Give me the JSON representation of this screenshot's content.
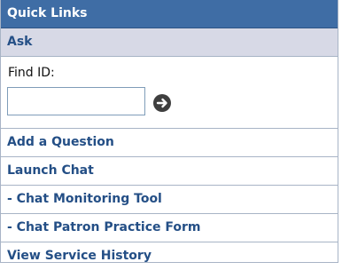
{
  "header": {
    "title": "Quick Links"
  },
  "ask_section": {
    "title": "Ask"
  },
  "find": {
    "label": "Find ID:",
    "value": "",
    "go_icon": "arrow-right-circle"
  },
  "links": [
    {
      "label": "Add a Question"
    },
    {
      "label": "Launch Chat"
    },
    {
      "label": "- Chat Monitoring Tool"
    },
    {
      "label": "- Chat Patron Practice Form"
    },
    {
      "label": "View Service History"
    }
  ],
  "colors": {
    "header_bg": "#3f6da5",
    "section_bg": "#d7d9e6",
    "link": "#244f86",
    "border": "#a8b4c6"
  }
}
